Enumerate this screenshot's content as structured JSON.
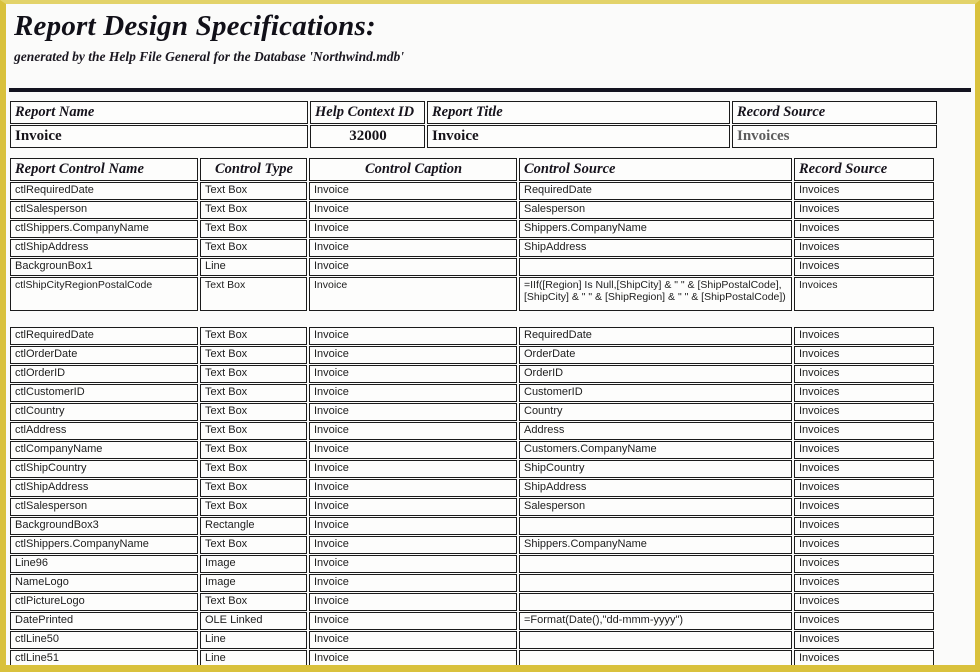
{
  "title": "Report Design Specifications:",
  "subtitle": "generated by the Help File General  for the Database 'Northwind.mdb'",
  "summary": {
    "headers": {
      "report_name": "Report Name",
      "help_context_id": "Help Context ID",
      "report_title": "Report Title",
      "record_source": "Record Source"
    },
    "values": {
      "report_name": "Invoice",
      "help_context_id": "32000",
      "report_title": "Invoice",
      "record_source": "Invoices"
    }
  },
  "controls": {
    "headers": [
      "Report Control Name",
      "Control Type",
      "Control Caption",
      "Control Source",
      "Record Source"
    ],
    "group1": [
      {
        "name": "ctlRequiredDate",
        "type": "Text Box",
        "caption": "Invoice",
        "source": "RequiredDate",
        "record": "Invoices"
      },
      {
        "name": "ctlSalesperson",
        "type": "Text Box",
        "caption": "Invoice",
        "source": "Salesperson",
        "record": "Invoices"
      },
      {
        "name": "ctlShippers.CompanyName",
        "type": "Text Box",
        "caption": "Invoice",
        "source": "Shippers.CompanyName",
        "record": "Invoices"
      },
      {
        "name": "ctlShipAddress",
        "type": "Text Box",
        "caption": "Invoice",
        "source": "ShipAddress",
        "record": "Invoices"
      },
      {
        "name": "BackgrounBox1",
        "type": "Line",
        "caption": "Invoice",
        "source": "",
        "record": "Invoices"
      },
      {
        "name": "ctlShipCityRegionPostalCode",
        "type": "Text Box",
        "caption": "Invoice",
        "source": "=IIf([Region] Is Null,[ShipCity] & \" \" & [ShipPostalCode],[ShipCity] & \" \" & [ShipRegion] & \" \" & [ShipPostalCode])",
        "record": "Invoices"
      }
    ],
    "group2": [
      {
        "name": "ctlRequiredDate",
        "type": "Text Box",
        "caption": "Invoice",
        "source": "RequiredDate",
        "record": "Invoices"
      },
      {
        "name": "ctlOrderDate",
        "type": "Text Box",
        "caption": "Invoice",
        "source": "OrderDate",
        "record": "Invoices"
      },
      {
        "name": "ctlOrderID",
        "type": "Text Box",
        "caption": "Invoice",
        "source": "OrderID",
        "record": "Invoices"
      },
      {
        "name": "ctlCustomerID",
        "type": "Text Box",
        "caption": "Invoice",
        "source": "CustomerID",
        "record": "Invoices"
      },
      {
        "name": "ctlCountry",
        "type": "Text Box",
        "caption": "Invoice",
        "source": "Country",
        "record": "Invoices"
      },
      {
        "name": "ctlAddress",
        "type": "Text Box",
        "caption": "Invoice",
        "source": "Address",
        "record": "Invoices"
      },
      {
        "name": "ctlCompanyName",
        "type": "Text Box",
        "caption": "Invoice",
        "source": "Customers.CompanyName",
        "record": "Invoices"
      },
      {
        "name": "ctlShipCountry",
        "type": "Text Box",
        "caption": "Invoice",
        "source": "ShipCountry",
        "record": "Invoices"
      },
      {
        "name": "ctlShipAddress",
        "type": "Text Box",
        "caption": "Invoice",
        "source": "ShipAddress",
        "record": "Invoices"
      },
      {
        "name": "ctlSalesperson",
        "type": "Text Box",
        "caption": "Invoice",
        "source": "Salesperson",
        "record": "Invoices"
      },
      {
        "name": "BackgroundBox3",
        "type": "Rectangle",
        "caption": "Invoice",
        "source": "",
        "record": "Invoices"
      },
      {
        "name": "ctlShippers.CompanyName",
        "type": "Text Box",
        "caption": "Invoice",
        "source": "Shippers.CompanyName",
        "record": "Invoices"
      },
      {
        "name": "Line96",
        "type": "Image",
        "caption": "Invoice",
        "source": "",
        "record": "Invoices"
      },
      {
        "name": "NameLogo",
        "type": "Image",
        "caption": "Invoice",
        "source": "",
        "record": "Invoices"
      },
      {
        "name": "ctlPictureLogo",
        "type": "Text Box",
        "caption": "Invoice",
        "source": "",
        "record": "Invoices"
      },
      {
        "name": "DatePrinted",
        "type": "OLE Linked",
        "caption": "Invoice",
        "source": "=Format(Date(),\"dd-mmm-yyyy\")",
        "record": "Invoices"
      },
      {
        "name": "ctlLine50",
        "type": "Line",
        "caption": "Invoice",
        "source": "",
        "record": "Invoices"
      },
      {
        "name": "ctlLine51",
        "type": "Line",
        "caption": "Invoice",
        "source": "",
        "record": "Invoices"
      }
    ]
  }
}
